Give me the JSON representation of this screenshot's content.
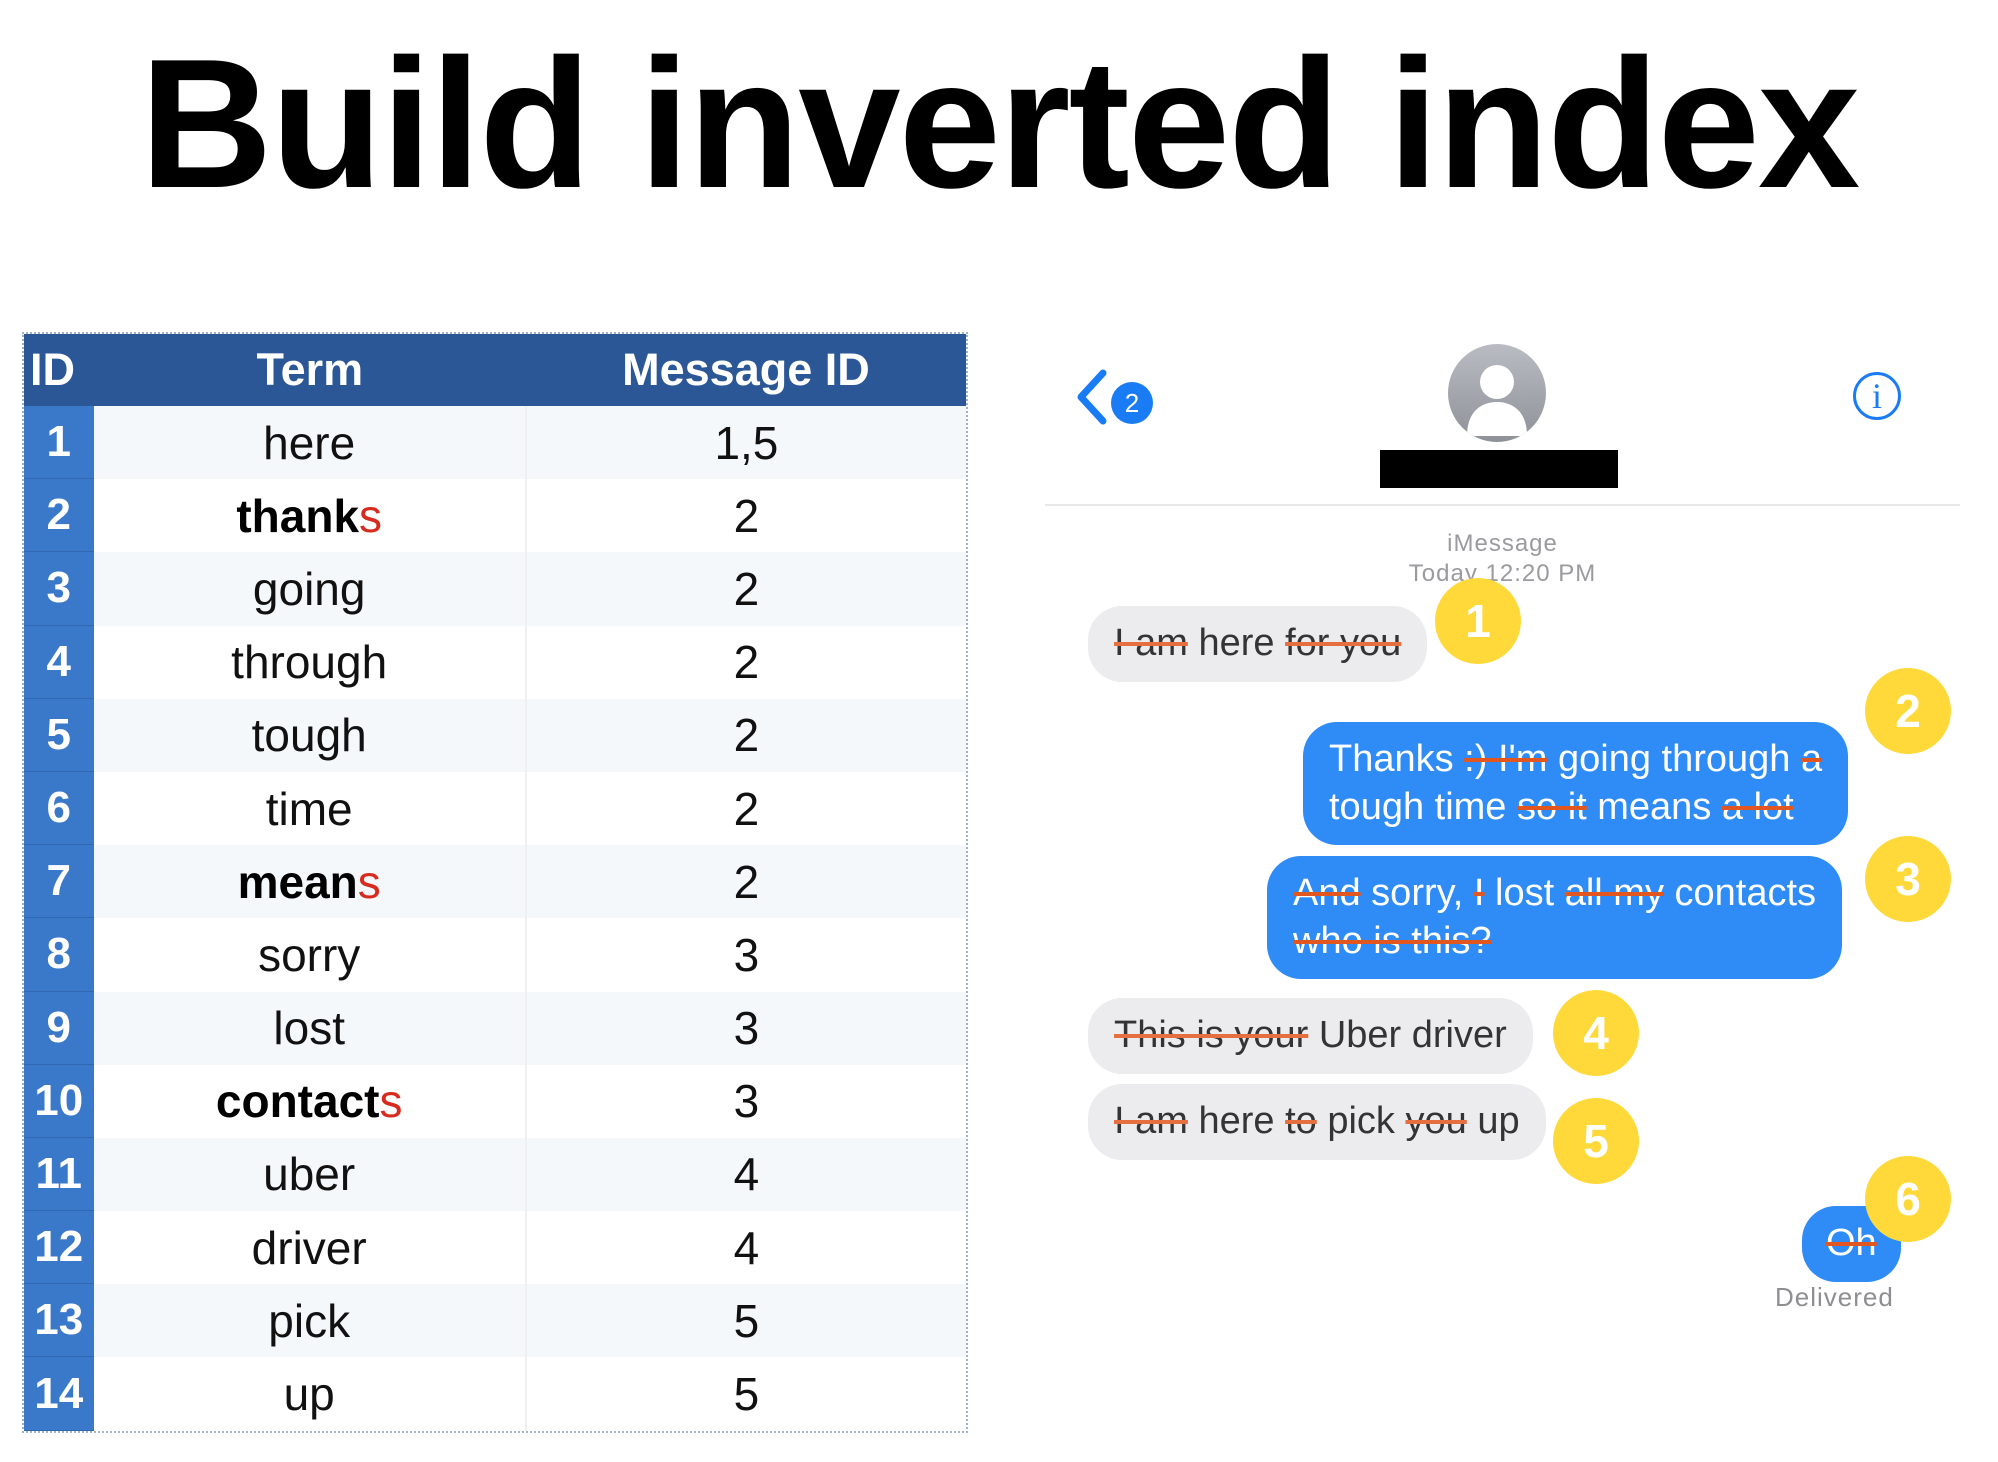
{
  "title": "Build inverted index",
  "table": {
    "headers": {
      "id": "ID",
      "term": "Term",
      "message_id": "Message ID"
    },
    "rows": [
      {
        "id": "1",
        "term": "here",
        "suffix": "",
        "message_id": "1,5"
      },
      {
        "id": "2",
        "term": "thank",
        "suffix": "s",
        "message_id": "2"
      },
      {
        "id": "3",
        "term": "going",
        "suffix": "",
        "message_id": "2"
      },
      {
        "id": "4",
        "term": "through",
        "suffix": "",
        "message_id": "2"
      },
      {
        "id": "5",
        "term": "tough",
        "suffix": "",
        "message_id": "2"
      },
      {
        "id": "6",
        "term": "time",
        "suffix": "",
        "message_id": "2"
      },
      {
        "id": "7",
        "term": "mean",
        "suffix": "s",
        "message_id": "2"
      },
      {
        "id": "8",
        "term": "sorry",
        "suffix": "",
        "message_id": "3"
      },
      {
        "id": "9",
        "term": "lost",
        "suffix": "",
        "message_id": "3"
      },
      {
        "id": "10",
        "term": "contact",
        "suffix": "s",
        "message_id": "3"
      },
      {
        "id": "11",
        "term": "uber",
        "suffix": "",
        "message_id": "4"
      },
      {
        "id": "12",
        "term": "driver",
        "suffix": "",
        "message_id": "4"
      },
      {
        "id": "13",
        "term": "pick",
        "suffix": "",
        "message_id": "5"
      },
      {
        "id": "14",
        "term": "up",
        "suffix": "",
        "message_id": "5"
      }
    ]
  },
  "chat": {
    "back_count": "2",
    "info_glyph": "i",
    "service": "iMessage",
    "timestamp": "Today 12:20 PM",
    "delivered": "Delivered",
    "messages": [
      {
        "number": "1",
        "direction": "in",
        "line1": [
          {
            "t": "I am",
            "s": true
          },
          {
            "t": " here ",
            "s": false
          },
          {
            "t": "for you",
            "s": true
          }
        ]
      },
      {
        "number": "2",
        "direction": "out",
        "line1": [
          {
            "t": "Thanks ",
            "s": false
          },
          {
            "t": ":) I'm",
            "s": true
          },
          {
            "t": " going through ",
            "s": false
          },
          {
            "t": "a",
            "s": true
          }
        ],
        "line2": [
          {
            "t": "tough time ",
            "s": false
          },
          {
            "t": "so it",
            "s": true
          },
          {
            "t": " means ",
            "s": false
          },
          {
            "t": "a lot",
            "s": true
          }
        ]
      },
      {
        "number": "3",
        "direction": "out",
        "line1": [
          {
            "t": "And",
            "s": true
          },
          {
            "t": " sorry, ",
            "s": false
          },
          {
            "t": "I",
            "s": true
          },
          {
            "t": " lost ",
            "s": false
          },
          {
            "t": "all my",
            "s": true
          },
          {
            "t": " contacts",
            "s": false
          }
        ],
        "line2": [
          {
            "t": "who is this?",
            "s": true
          }
        ]
      },
      {
        "number": "4",
        "direction": "in",
        "line1": [
          {
            "t": "This is your",
            "s": true
          },
          {
            "t": " Uber driver",
            "s": false
          }
        ]
      },
      {
        "number": "5",
        "direction": "in",
        "line1": [
          {
            "t": "I am",
            "s": true
          },
          {
            "t": " here ",
            "s": false
          },
          {
            "t": "to",
            "s": true
          },
          {
            "t": " pick ",
            "s": false
          },
          {
            "t": "you",
            "s": true
          },
          {
            "t": " up",
            "s": false
          }
        ]
      },
      {
        "number": "6",
        "direction": "out",
        "line1": [
          {
            "t": "Oh",
            "s": true
          }
        ]
      }
    ]
  },
  "colors": {
    "header_blue": "#2b5797",
    "id_column_blue": "#3a78c9",
    "suffix_red": "#d62b1e",
    "strike_orange": "#e2561f",
    "imessage_blue": "#2f8cf6",
    "badge_yellow": "#ffd93a"
  }
}
